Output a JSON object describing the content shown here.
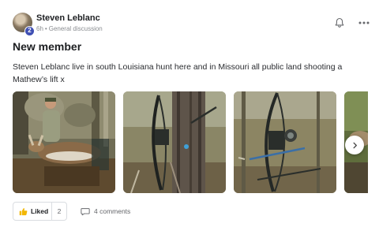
{
  "post": {
    "author": {
      "name": "Steven Leblanc",
      "badge": "2",
      "time": "6h",
      "separator": "•",
      "category": "General discussion"
    },
    "title": "New member",
    "body": "Steven Leblanc live in south Louisiana hunt here and in Missouri all public land shooting a Mathew’s lift x",
    "photos": [
      {
        "name": "hunter-with-deer-photo"
      },
      {
        "name": "bow-on-tree-photo"
      },
      {
        "name": "bow-closeup-photo"
      },
      {
        "name": "deer-partial-photo"
      }
    ],
    "actions": {
      "like_label": "Liked",
      "like_count": "2",
      "comments_label": "4 comments"
    }
  },
  "icons": {
    "bell": "bell-icon",
    "more": "more-dots-icon",
    "next": "chevron-right-icon",
    "thumbs_up": "thumbs-up-icon",
    "comment": "comment-icon"
  },
  "colors": {
    "badge": "#3f4fb3",
    "text": "#1c1e21",
    "muted": "#8a8d91"
  }
}
